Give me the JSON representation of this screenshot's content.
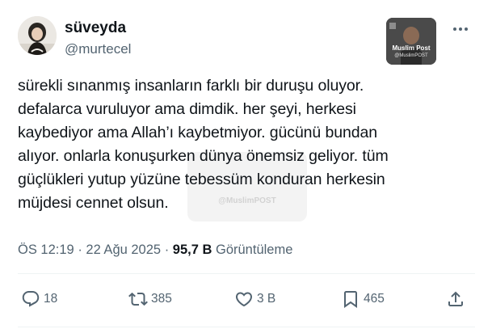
{
  "author": {
    "display_name": "süveyda",
    "handle": "@murtecel",
    "avatar_icon": "profile-photo"
  },
  "watermark": {
    "brand": "Muslim Post",
    "brand_handle": "@MuslimPOST",
    "center_handle": "@MuslimPOST"
  },
  "tweet": {
    "lines": [
      "sürekli sınanmış insanların farklı bir duruşu oluyor.",
      "defalarca vuruluyor ama dimdik. her şeyi, herkesi",
      "kaybediyor ama Allah’ı kaybetmiyor. gücünü bundan",
      "alıyor. onlarla konuşurken dünya önemsiz geliyor. tüm",
      "güçlükleri yutup yüzüne tebessüm konduran herkesin",
      "müjdesi cennet olsun."
    ]
  },
  "meta": {
    "time": "ÖS 12:19",
    "separator": "·",
    "date": "22 Ağu 2025",
    "views_count": "95,7 B",
    "views_label": "Görüntüleme"
  },
  "actions": {
    "reply_count": "18",
    "retweet_count": "385",
    "like_count": "3 B",
    "bookmark_count": "465"
  },
  "colors": {
    "text": "#0f1419",
    "secondary": "#536471",
    "divider": "#eff3f4"
  }
}
